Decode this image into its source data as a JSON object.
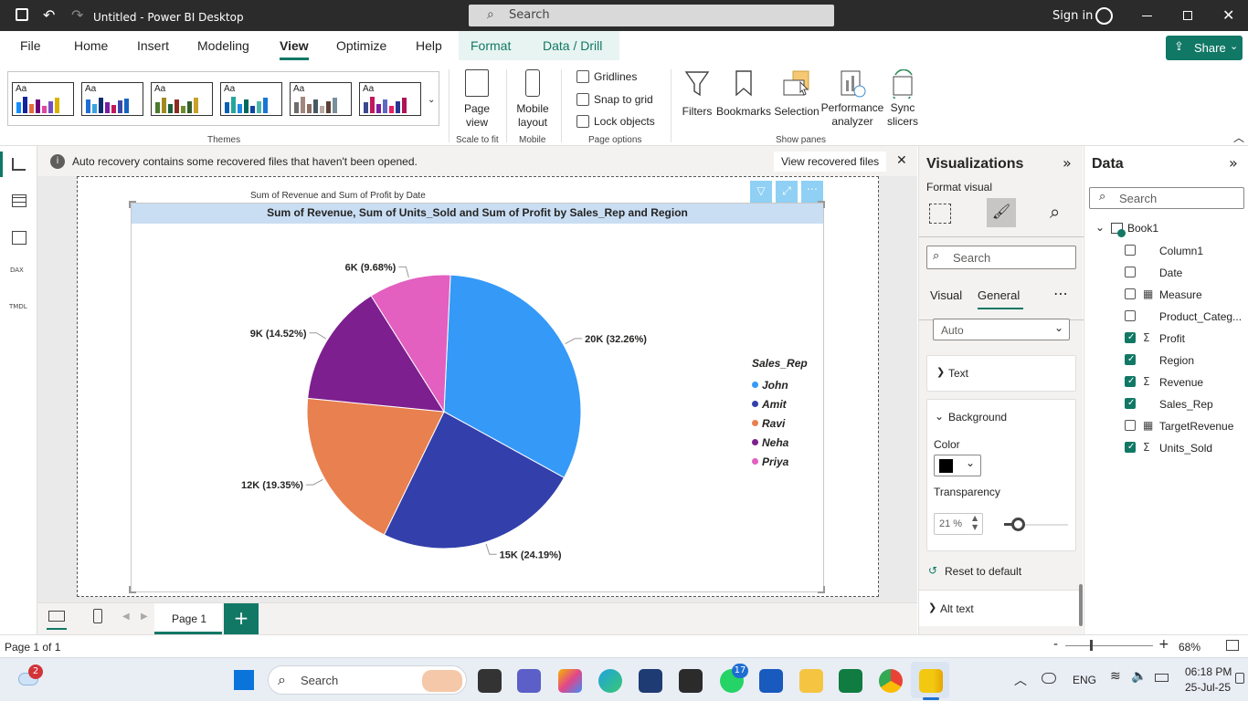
{
  "window": {
    "title": "Untitled - Power BI Desktop",
    "search_placeholder": "Search",
    "signin": "Sign in"
  },
  "menu": {
    "items": [
      "File",
      "Home",
      "Insert",
      "Modeling",
      "View",
      "Optimize",
      "Help",
      "Format",
      "Data / Drill"
    ],
    "active": "View",
    "share": "Share"
  },
  "ribbon": {
    "themes_label": "Themes",
    "page_view": "Page view",
    "scale_label": "Scale to fit",
    "mobile_layout": "Mobile layout",
    "mobile_label": "Mobile",
    "gridlines": "Gridlines",
    "snap": "Snap to grid",
    "lock": "Lock objects",
    "page_options_label": "Page options",
    "filters": "Filters",
    "bookmarks": "Bookmarks",
    "selection": "Selection",
    "performance": "Performance analyzer",
    "sync": "Sync slicers",
    "show_panes_label": "Show panes"
  },
  "info": {
    "message": "Auto recovery contains some recovered files that haven't been opened.",
    "button": "View recovered files"
  },
  "visual": {
    "behind_title": "Sum of Revenue and Sum of Profit by Date",
    "title": "Sum of Revenue, Sum of Units_Sold and Sum of Profit by Sales_Rep and Region",
    "legend_title": "Sales_Rep"
  },
  "chart_data": {
    "type": "pie",
    "title": "Sum of Revenue, Sum of Units_Sold and Sum of Profit by Sales_Rep and Region",
    "categories": [
      "John",
      "Amit",
      "Ravi",
      "Neha",
      "Priya"
    ],
    "values": [
      20000,
      15000,
      12000,
      9000,
      6000
    ],
    "percent": [
      32.26,
      24.19,
      19.35,
      14.52,
      9.68
    ],
    "labels": [
      "20K (32.26%)",
      "15K (24.19%)",
      "12K (19.35%)",
      "9K (14.52%)",
      "6K (9.68%)"
    ],
    "colors": [
      "#3599f8",
      "#333fab",
      "#e8804f",
      "#7d1f8f",
      "#e35fc0"
    ],
    "legend": "right"
  },
  "pages": {
    "tab": "Page 1",
    "status": "Page 1 of 1",
    "zoom": "68%"
  },
  "viz": {
    "title": "Visualizations",
    "format_visual": "Format visual",
    "search": "Search",
    "tab_visual": "Visual",
    "tab_general": "General",
    "auto": "Auto",
    "text": "Text",
    "background": "Background",
    "color_label": "Color",
    "color_value": "#000000",
    "transparency_label": "Transparency",
    "transparency_value": "21 %",
    "transparency_fraction": 0.21,
    "reset": "Reset to default",
    "alt_text": "Alt text"
  },
  "data": {
    "title": "Data",
    "search": "Search",
    "table": "Book1",
    "fields": [
      {
        "name": "Column1",
        "checked": false,
        "icon": ""
      },
      {
        "name": "Date",
        "checked": false,
        "icon": ""
      },
      {
        "name": "Measure",
        "checked": false,
        "icon": "calculator-icon"
      },
      {
        "name": "Product_Categ...",
        "checked": false,
        "icon": ""
      },
      {
        "name": "Profit",
        "checked": true,
        "icon": "sigma-icon"
      },
      {
        "name": "Region",
        "checked": true,
        "icon": ""
      },
      {
        "name": "Revenue",
        "checked": true,
        "icon": "sigma-icon"
      },
      {
        "name": "Sales_Rep",
        "checked": true,
        "icon": ""
      },
      {
        "name": "TargetRevenue",
        "checked": false,
        "icon": "calculator-icon"
      },
      {
        "name": "Units_Sold",
        "checked": true,
        "icon": "sigma-icon"
      }
    ]
  },
  "taskbar": {
    "search": "Search",
    "lang": "ENG",
    "time": "06:18 PM",
    "date": "25-Jul-25",
    "weather_badge": "2",
    "whatsapp_badge": "17"
  }
}
